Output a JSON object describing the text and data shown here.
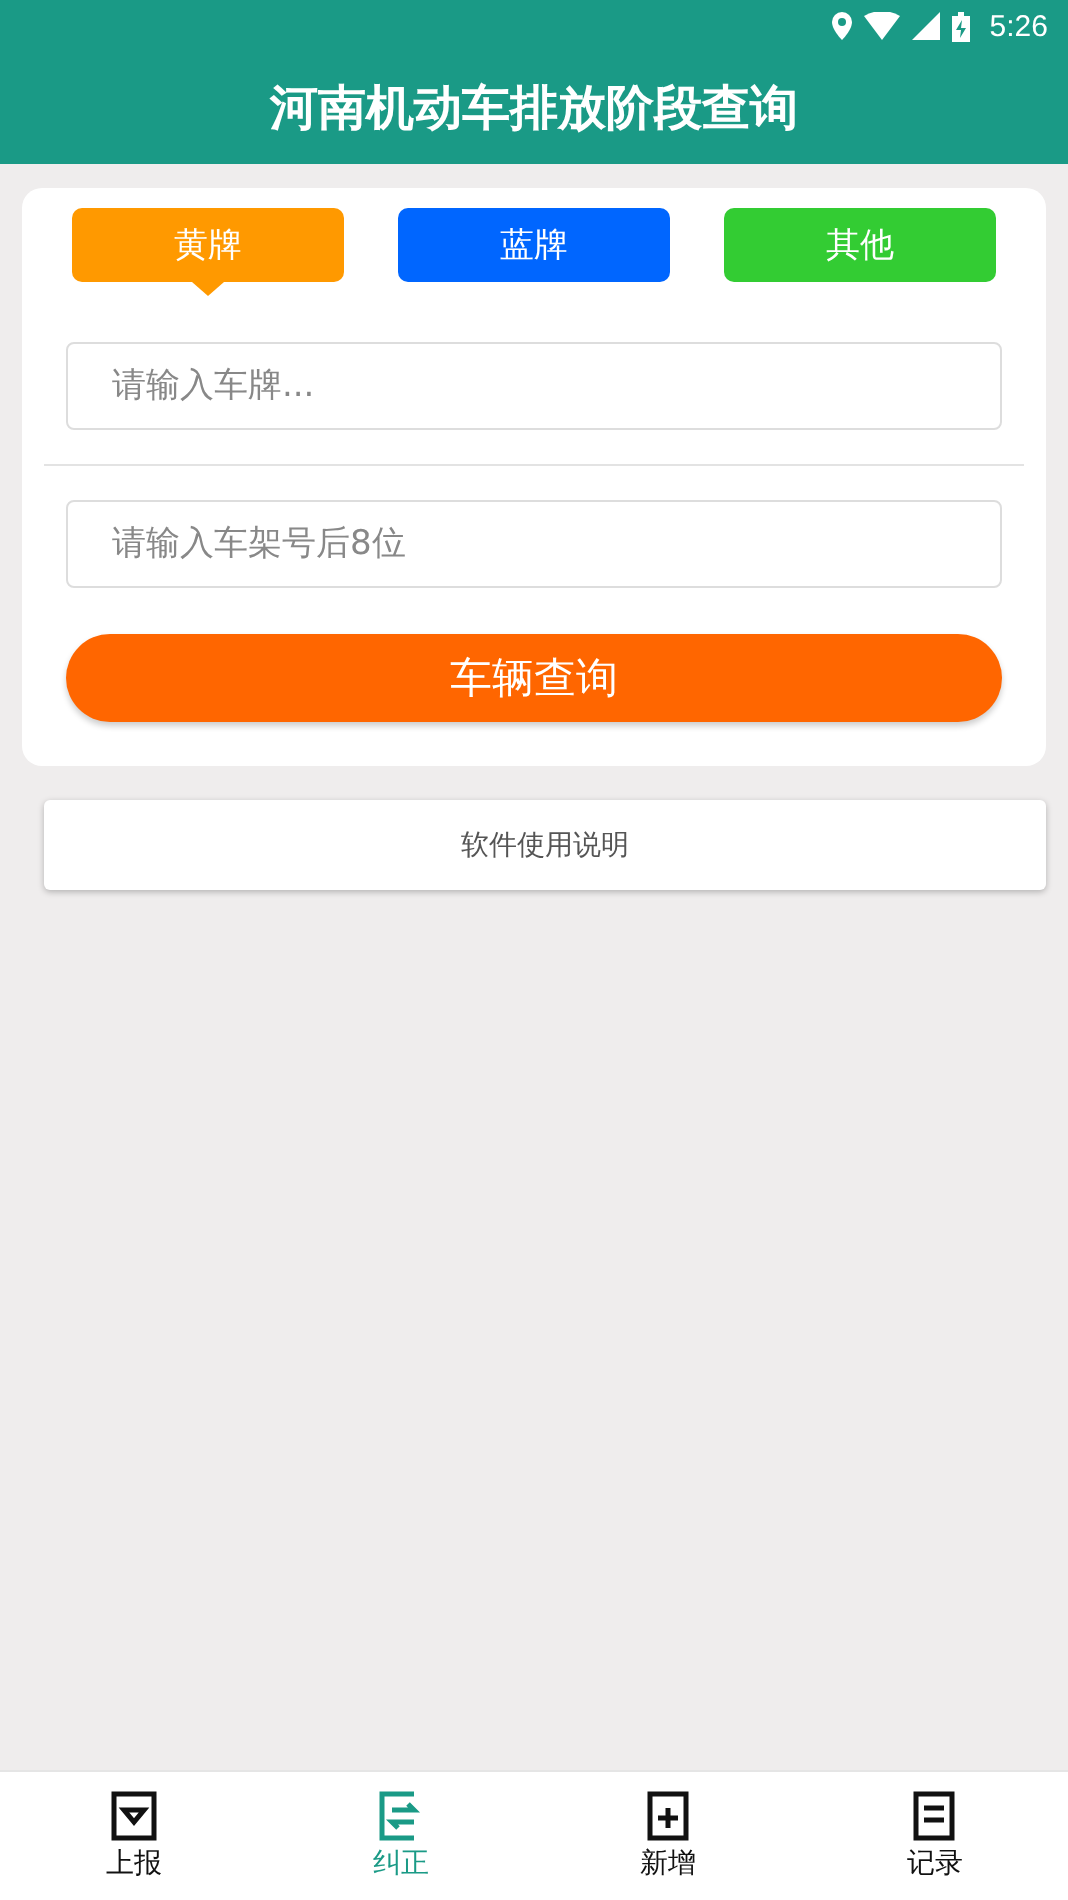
{
  "status_bar": {
    "time": "5:26"
  },
  "header": {
    "title": "河南机动车排放阶段查询"
  },
  "plate_tabs": [
    {
      "label": "黄牌",
      "selected": true,
      "color": "#ff9900"
    },
    {
      "label": "蓝牌",
      "selected": false,
      "color": "#0066ff"
    },
    {
      "label": "其他",
      "selected": false,
      "color": "#33cc33"
    }
  ],
  "plate_field": {
    "placeholder": "请输入车牌..."
  },
  "vin_field": {
    "placeholder": "请输入车架号后8位"
  },
  "query_button": "车辆查询",
  "help_button": "软件使用说明",
  "bottom_nav": [
    {
      "label": "上报",
      "kind": "report",
      "selected": false
    },
    {
      "label": "纠正",
      "kind": "correct",
      "selected": true
    },
    {
      "label": "新增",
      "kind": "add",
      "selected": false
    },
    {
      "label": "记录",
      "kind": "record",
      "selected": false
    }
  ]
}
